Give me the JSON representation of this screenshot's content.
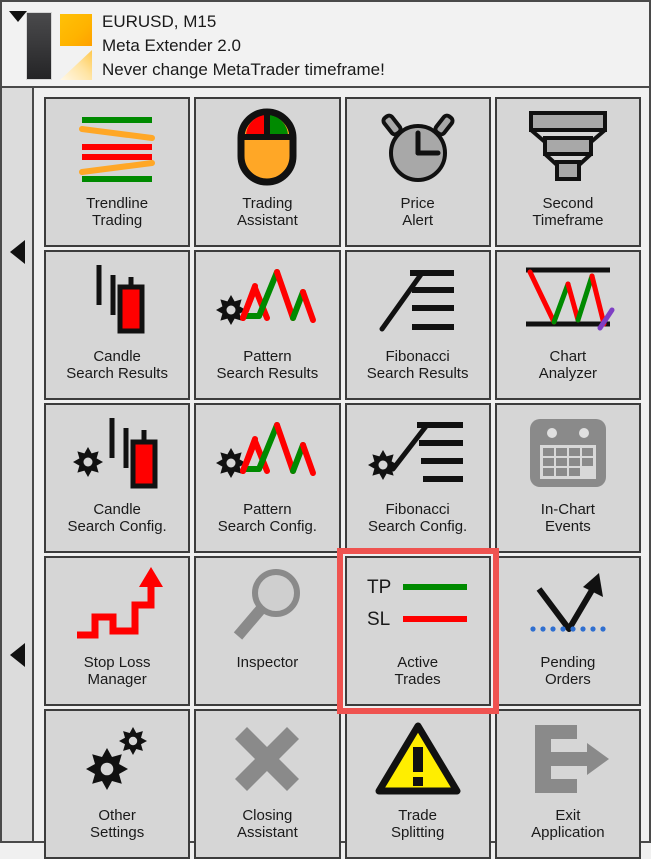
{
  "window": {
    "collapse_icon": "caret-down-icon",
    "logo_icon": "meta-extender-logo"
  },
  "header": {
    "symbol_line": "EURUSD, M15",
    "product_line": "Meta Extender 2.0",
    "warning_line": "Never change MetaTrader timeframe!"
  },
  "rail": {
    "arrow_top_icon": "caret-left-icon",
    "arrow_bottom_icon": "caret-left-icon"
  },
  "colors": {
    "tile_face": "#d6d6d6",
    "tile_border": "#3c3c3c",
    "selection": "#ef5350",
    "green": "#008a00",
    "red": "#ff0000",
    "orange": "#ffa726",
    "grey_icon": "#8a8a8a",
    "yellow": "#ffee00",
    "purple": "#7e3fc4",
    "blue_dots": "#2f6fd0"
  },
  "tiles": [
    {
      "id": "trendline-trading",
      "label": "Trendline\nTrading",
      "icon": "trendlines-icon",
      "selected": false
    },
    {
      "id": "trading-assistant",
      "label": "Trading\nAssistant",
      "icon": "mouse-icon",
      "selected": false
    },
    {
      "id": "price-alert",
      "label": "Price\nAlert",
      "icon": "alarm-clock-icon",
      "selected": false
    },
    {
      "id": "second-timeframe",
      "label": "Second\nTimeframe",
      "icon": "funnel-icon",
      "selected": false
    },
    {
      "id": "candle-search-results",
      "label": "Candle\nSearch Results",
      "icon": "candlestick-icon",
      "selected": false
    },
    {
      "id": "pattern-search-results",
      "label": "Pattern\nSearch Results",
      "icon": "zigzag-gear-icon",
      "selected": false
    },
    {
      "id": "fibonacci-search-results",
      "label": "Fibonacci\nSearch Results",
      "icon": "fibonacci-icon",
      "selected": false
    },
    {
      "id": "chart-analyzer",
      "label": "Chart\nAnalyzer",
      "icon": "chart-analyzer-icon",
      "selected": false
    },
    {
      "id": "candle-search-config",
      "label": "Candle\nSearch Config.",
      "icon": "candlestick-gear-icon",
      "selected": false
    },
    {
      "id": "pattern-search-config",
      "label": "Pattern\nSearch Config.",
      "icon": "zigzag-gear-icon",
      "selected": false
    },
    {
      "id": "fibonacci-search-config",
      "label": "Fibonacci\nSearch Config.",
      "icon": "fibonacci-gear-icon",
      "selected": false
    },
    {
      "id": "in-chart-events",
      "label": "In-Chart\nEvents",
      "icon": "calendar-icon",
      "selected": false
    },
    {
      "id": "stop-loss-manager",
      "label": "Stop Loss\nManager",
      "icon": "stairs-arrow-icon",
      "selected": false
    },
    {
      "id": "inspector",
      "label": "Inspector",
      "icon": "magnifier-icon",
      "selected": false
    },
    {
      "id": "active-trades",
      "label": "Active\nTrades",
      "icon": "tp-sl-icon",
      "selected": true
    },
    {
      "id": "pending-orders",
      "label": "Pending\nOrders",
      "icon": "pending-arrow-icon",
      "selected": false
    },
    {
      "id": "other-settings",
      "label": "Other\nSettings",
      "icon": "gears-icon",
      "selected": false
    },
    {
      "id": "closing-assistant",
      "label": "Closing\nAssistant",
      "icon": "close-x-icon",
      "selected": false
    },
    {
      "id": "trade-splitting",
      "label": "Trade\nSplitting",
      "icon": "warning-triangle-icon",
      "selected": false
    },
    {
      "id": "exit-application",
      "label": "Exit\nApplication",
      "icon": "exit-arrow-icon",
      "selected": false
    }
  ],
  "icon_labels": {
    "tp": "TP",
    "sl": "SL"
  }
}
